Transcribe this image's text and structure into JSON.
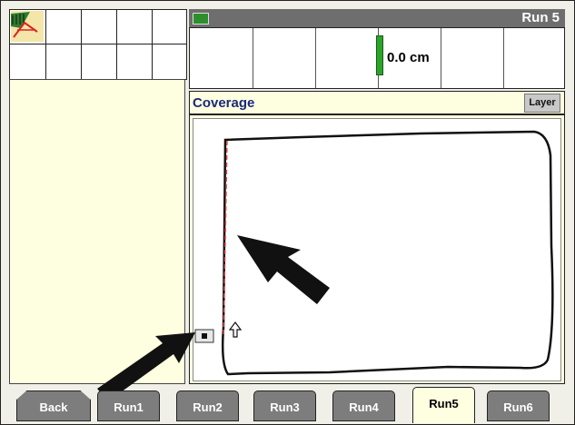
{
  "header": {
    "title": "Run 5"
  },
  "guidance": {
    "offset": "0.0 cm"
  },
  "coverage": {
    "label": "Coverage",
    "layer_button": "Layer"
  },
  "tabs": [
    {
      "label": "Back"
    },
    {
      "label": "Run1"
    },
    {
      "label": "Run2"
    },
    {
      "label": "Run3"
    },
    {
      "label": "Run4"
    },
    {
      "label": "Run5",
      "active": true
    },
    {
      "label": "Run6"
    }
  ],
  "colors": {
    "header_bg": "#6e6e6e",
    "panel_bg": "#fefee0",
    "tab_bg": "#7d7d7d",
    "guidance_bar": "#2aa52a",
    "coverage_label": "#1a2a7a"
  },
  "icons": [
    "field-map-icon",
    "flag-icon",
    "position-marker-icon",
    "direction-arrow-icon",
    "pointer-arrow-icon"
  ]
}
